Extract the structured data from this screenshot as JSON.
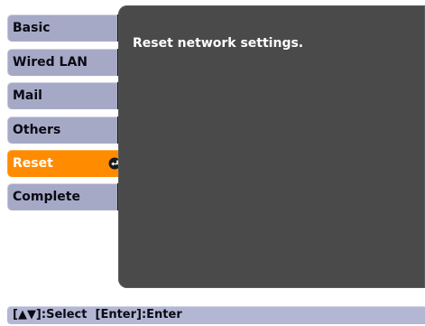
{
  "sidebar": {
    "items": [
      {
        "label": "Basic"
      },
      {
        "label": "Wired LAN"
      },
      {
        "label": "Mail"
      },
      {
        "label": "Others"
      },
      {
        "label": "Reset",
        "active": true
      },
      {
        "label": "Complete"
      }
    ]
  },
  "panel": {
    "message": "Reset network settings."
  },
  "footer": {
    "select_hint": "[▲▼]:Select",
    "enter_hint": "[Enter]:Enter"
  },
  "colors": {
    "active": "#ff8c00",
    "inactive": "#a6a9c6",
    "panel": "#4a4a4a"
  }
}
